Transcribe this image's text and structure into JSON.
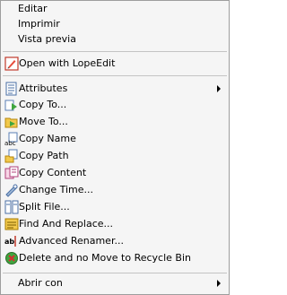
{
  "menu": {
    "top_items": [
      {
        "label": "Editar"
      },
      {
        "label": "Imprimir"
      },
      {
        "label": "Vista previa"
      }
    ],
    "open_with": {
      "label": "Open with LopeEdit",
      "icon": "pencil-icon"
    },
    "items": [
      {
        "label": "Attributes",
        "icon": "attributes-icon",
        "submenu": true
      },
      {
        "label": "Copy To...",
        "icon": "copy-to-icon"
      },
      {
        "label": "Move To...",
        "icon": "move-to-icon"
      },
      {
        "label": "Copy Name",
        "icon": "copy-name-icon"
      },
      {
        "label": "Copy Path",
        "icon": "copy-path-icon"
      },
      {
        "label": "Copy Content",
        "icon": "copy-content-icon"
      },
      {
        "label": "Change Time...",
        "icon": "change-time-icon"
      },
      {
        "label": "Split File...",
        "icon": "split-file-icon"
      },
      {
        "label": "Find And Replace...",
        "icon": "find-replace-icon"
      },
      {
        "label": "Advanced Renamer...",
        "icon": "renamer-icon"
      },
      {
        "label": "Delete and no Move to Recycle Bin",
        "icon": "delete-icon"
      }
    ],
    "abrir_con": {
      "label": "Abrir con",
      "submenu": true
    }
  }
}
